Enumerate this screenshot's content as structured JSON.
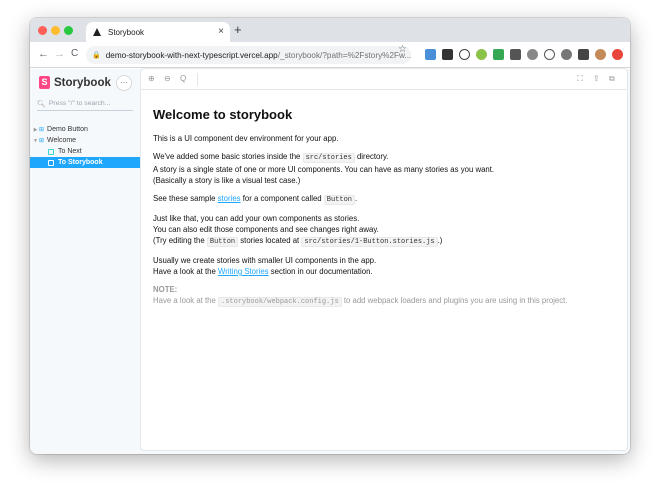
{
  "browser": {
    "tab_title": "Storybook",
    "tab_close": "×",
    "new_tab": "+",
    "nav": {
      "back": "←",
      "forward": "→",
      "reload": "C"
    },
    "url_host": "demo-storybook-with-next-typescript.vercel.app",
    "url_path": "/_storybook/?path=%2Fstory%2Fw...",
    "bookmark_icon": "star-icon",
    "colors": {
      "tabstrip": "#dee1e6",
      "omnibox": "#f1f3f4"
    }
  },
  "storybook": {
    "brand": "Storybook",
    "brand_badge": "S",
    "menu_label": "···",
    "search_placeholder": "Press \"/\" to search...",
    "tree": [
      {
        "label": "Demo Button",
        "kind": "component",
        "expanded": false
      },
      {
        "label": "Welcome",
        "kind": "component",
        "expanded": true
      },
      {
        "label": "To Next",
        "kind": "story",
        "selected": false
      },
      {
        "label": "To Storybook",
        "kind": "story",
        "selected": true
      }
    ],
    "accent": "#1ea7fd",
    "brand_color": "#ff4785"
  },
  "preview_toolbar": {
    "zoom_in": "⊕",
    "zoom_out": "⊖",
    "zoom_reset": "Q",
    "fullscreen": "⛶",
    "share": "⇪",
    "copy": "⧉"
  },
  "doc": {
    "title": "Welcome to storybook",
    "p1": "This is a UI component dev environment for your app.",
    "p2_a": "We've added some basic stories inside the",
    "p2_code": "src/stories",
    "p2_b": "directory.",
    "p2_c": "A story is a single state of one or more UI components. You can have as many stories as you want.",
    "p2_d": "(Basically a story is like a visual test case.)",
    "p3_a": "See these sample",
    "p3_link": "stories",
    "p3_b": "for a component called",
    "p3_code": "Button",
    "p3_c": ".",
    "p4_a": "Just like that, you can add your own components as stories.",
    "p4_b": "You can also edit those components and see changes right away.",
    "p4_c": "(Try editing the",
    "p4_code1": "Button",
    "p4_d": "stories located at",
    "p4_code2": "src/stories/1-Button.stories.js",
    "p4_e": ".)",
    "p5_a": "Usually we create stories with smaller UI components in the app.",
    "p5_b": "Have a look at the",
    "p5_link": "Writing Stories",
    "p5_c": "section in our documentation.",
    "note_title": "NOTE:",
    "note_a": "Have a look at the",
    "note_code": ".storybook/webpack.config.js",
    "note_b": "to add webpack loaders and plugins you are using in this project."
  }
}
